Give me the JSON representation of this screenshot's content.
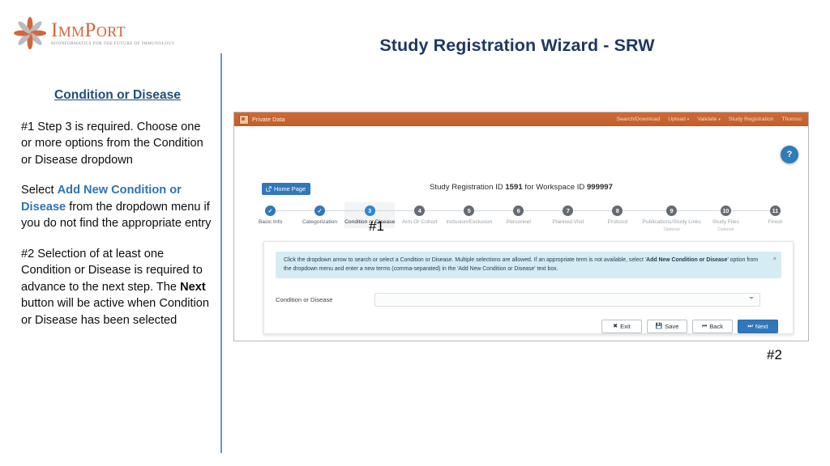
{
  "logo": {
    "word": "ImmPort",
    "tagline": "Bioinformatics for the Future of Immunology"
  },
  "slide": {
    "title": "Study Registration Wizard - SRW",
    "callout_1": "#1",
    "callout_2": "#2"
  },
  "notes": {
    "heading": "Condition or Disease",
    "para1_a": "#1  Step 3 is required.  Choose one or more options from the Condition or Disease dropdown",
    "para2_lead": "Select ",
    "para2_accent": "Add New Condition or Disease",
    "para2_tail": " from the dropdown menu if you do not find the appropriate entry",
    "para3_lead": "#2  Selection of at least one Condition or Disease is required to advance to the next step.  The ",
    "para3_bold": "Next",
    "para3_tail": " button will be active when Condition or Disease has been selected"
  },
  "app": {
    "topbar": {
      "brand": "Private Data",
      "brand_icon": "immport-flower-icon",
      "nav": [
        {
          "label": "Search/Download",
          "caret": false
        },
        {
          "label": "Upload",
          "caret": true
        },
        {
          "label": "Validate",
          "caret": true
        },
        {
          "label": "Study Registration",
          "caret": false
        },
        {
          "label": "Thomso",
          "caret": false
        }
      ],
      "caret_glyph": "▾"
    },
    "help_badge": "?",
    "home_page_button": "Home Page",
    "registration_line": {
      "prefix": "Study Registration ID ",
      "registration_id": "1591",
      "middle": " for Workspace ID ",
      "workspace_id": "999997"
    },
    "steps": [
      {
        "num": "✓",
        "label": "Basic Info",
        "state": "done",
        "optional": ""
      },
      {
        "num": "✓",
        "label": "Categorization",
        "state": "done",
        "optional": ""
      },
      {
        "num": "3",
        "label": "Condition or Disease",
        "state": "active",
        "optional": ""
      },
      {
        "num": "4",
        "label": "Arm Or Cohort",
        "state": "todo",
        "optional": ""
      },
      {
        "num": "5",
        "label": "Inclusion/Exclusion",
        "state": "todo",
        "optional": ""
      },
      {
        "num": "6",
        "label": "Personnel",
        "state": "todo",
        "optional": ""
      },
      {
        "num": "7",
        "label": "Planned Visit",
        "state": "todo",
        "optional": ""
      },
      {
        "num": "8",
        "label": "Protocol",
        "state": "todo",
        "optional": ""
      },
      {
        "num": "9",
        "label": "Publications/Study Links",
        "state": "todo",
        "optional": "Optional"
      },
      {
        "num": "10",
        "label": "Study Files",
        "state": "todo",
        "optional": "Optional"
      },
      {
        "num": "11",
        "label": "Finish",
        "state": "todo",
        "optional": ""
      }
    ],
    "info_banner": {
      "text_1": "Click the dropdown arrow to search or select a Condition or Disease. Multiple selections are allowed. If an appropriate term is not available, select '",
      "bold_term": "Add New Condition or Disease",
      "text_2": "' option from the dropdown menu and enter a new terms (comma-separated) in the 'Add New Condition or Disease' text box.",
      "close": "×"
    },
    "form": {
      "label": "Condition or Disease",
      "value": "",
      "placeholder": ""
    },
    "actions": [
      {
        "icon": "✖",
        "label": "Exit",
        "primary": false,
        "name": "exit-button"
      },
      {
        "icon": "💾",
        "label": "Save",
        "primary": false,
        "name": "save-button"
      },
      {
        "icon": "⏮",
        "label": "Back",
        "primary": false,
        "name": "back-button"
      },
      {
        "icon": "⏭",
        "label": "Next",
        "primary": true,
        "name": "next-button"
      }
    ]
  },
  "colors": {
    "brand_orange": "#c05f2c",
    "accent_blue": "#3178bb",
    "title_navy": "#1f3864",
    "banner_blue": "#d6ecf5"
  }
}
